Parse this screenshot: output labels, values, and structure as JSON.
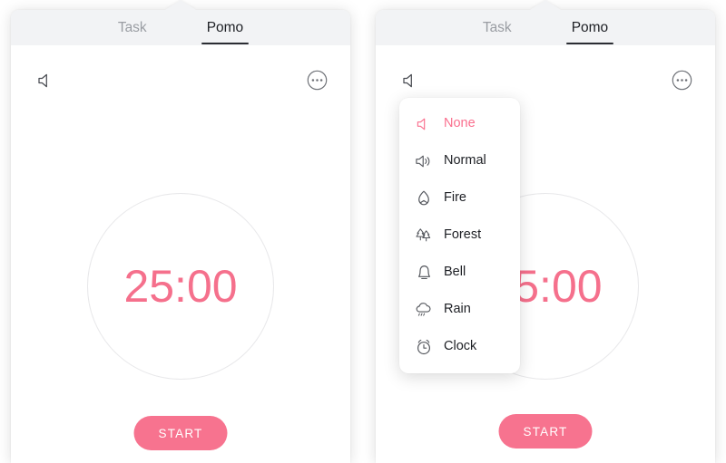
{
  "app": {
    "accent_pink": "#f7738f",
    "accent_pink_text": "#f5708c",
    "selected_pink": "#fa6f8e",
    "tabbar_bg": "#f2f3f5",
    "icon_gray": "#55585e",
    "circle_border": "#e8e8ea"
  },
  "tabs": [
    {
      "label": "Task",
      "active": false
    },
    {
      "label": "Pomo",
      "active": true
    }
  ],
  "toolbar": {
    "sound_icon": "speaker-mute-icon",
    "more_icon": "more-horizontal-circle-icon"
  },
  "timer": {
    "value": "25:00"
  },
  "actions": {
    "start_label": "START"
  },
  "sound_menu": {
    "items": [
      {
        "label": "None",
        "icon": "speaker-mute-icon",
        "selected": true
      },
      {
        "label": "Normal",
        "icon": "speaker-wave-icon",
        "selected": false
      },
      {
        "label": "Fire",
        "icon": "flame-icon",
        "selected": false
      },
      {
        "label": "Forest",
        "icon": "pine-trees-icon",
        "selected": false
      },
      {
        "label": "Bell",
        "icon": "bell-icon",
        "selected": false
      },
      {
        "label": "Rain",
        "icon": "rain-cloud-icon",
        "selected": false
      },
      {
        "label": "Clock",
        "icon": "alarm-clock-icon",
        "selected": false
      }
    ]
  }
}
